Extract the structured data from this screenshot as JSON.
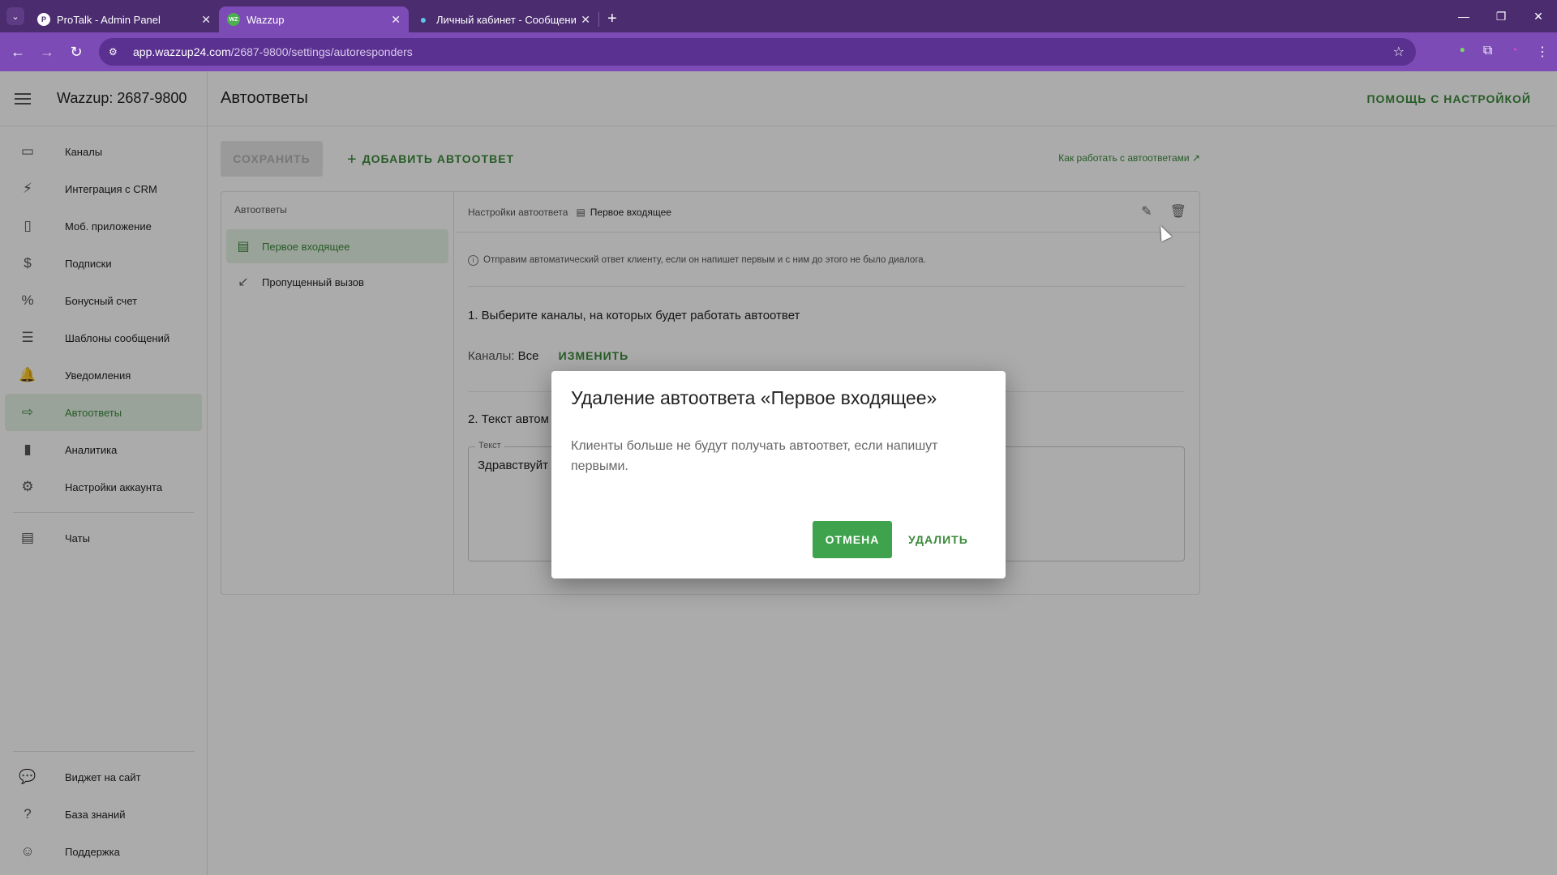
{
  "browser": {
    "tabs": [
      {
        "title": "ProTalk - Admin Panel",
        "favicon": "P",
        "active": false
      },
      {
        "title": "Wazzup",
        "favicon": "WZ",
        "active": true
      },
      {
        "title": "Личный кабинет - Сообщени",
        "favicon": "●",
        "active": false
      }
    ],
    "url_host": "app.wazzup24.com",
    "url_path": "/2687-9800/settings/autoresponders"
  },
  "sidebar": {
    "account": "Wazzup: 2687-9800",
    "items": [
      {
        "label": "Каналы",
        "icon": "devices-icon",
        "glyph": "▭"
      },
      {
        "label": "Интеграция с CRM",
        "icon": "plug-icon",
        "glyph": "⚡"
      },
      {
        "label": "Моб. приложение",
        "icon": "phone-icon",
        "glyph": "▯"
      },
      {
        "label": "Подписки",
        "icon": "dollar-icon",
        "glyph": "$"
      },
      {
        "label": "Бонусный счет",
        "icon": "percent-icon",
        "glyph": "%"
      },
      {
        "label": "Шаблоны сообщений",
        "icon": "template-icon",
        "glyph": "☰"
      },
      {
        "label": "Уведомления",
        "icon": "bell-icon",
        "glyph": "🔔"
      },
      {
        "label": "Автоответы",
        "icon": "autoreply-icon",
        "glyph": "⇨",
        "active": true
      },
      {
        "label": "Аналитика",
        "icon": "chart-icon",
        "glyph": "▮"
      },
      {
        "label": "Настройки аккаунта",
        "icon": "gear-icon",
        "glyph": "⚙"
      }
    ],
    "chats": {
      "label": "Чаты",
      "icon": "chats-icon",
      "glyph": "▤"
    },
    "bottom": [
      {
        "label": "Виджет на сайт",
        "icon": "widget-icon",
        "glyph": "💬"
      },
      {
        "label": "База знаний",
        "icon": "help-icon",
        "glyph": "?"
      },
      {
        "label": "Поддержка",
        "icon": "support-icon",
        "glyph": "☺"
      }
    ]
  },
  "main": {
    "title": "Автоответы",
    "help": "ПОМОЩЬ С НАСТРОЙКОЙ",
    "save": "СОХРАНИТЬ",
    "add": "ДОБАВИТЬ АВТООТВЕТ",
    "howto": "Как работать с автоответами",
    "list_title": "Автоответы",
    "list": [
      {
        "label": "Первое входящее",
        "icon": "message-icon",
        "active": true
      },
      {
        "label": "Пропущенный вызов",
        "icon": "missed-call-icon",
        "active": false
      }
    ],
    "settings_label": "Настройки автоответа",
    "settings_name": "Первое входящее",
    "info": "Отправим автоматический ответ клиенту, если он напишет первым и с ним до этого не было диалога.",
    "step1": "1. Выберите каналы, на которых будет работать автоответ",
    "channels_label": "Каналы:",
    "channels_value": "Все",
    "change": "ИЗМЕНИТЬ",
    "step2": "2. Текст автом",
    "text_label": "Текст",
    "text_value": "Здравствуйт"
  },
  "dialog": {
    "title": "Удаление автоответа «Первое входящее»",
    "body": "Клиенты больше не будут получать автоответ, если напишут первыми.",
    "cancel": "ОТМЕНА",
    "delete": "УДАЛИТЬ"
  },
  "colors": {
    "brand": "#7c4bb5",
    "accent": "#3b8a3b",
    "button": "#3fa34d"
  }
}
